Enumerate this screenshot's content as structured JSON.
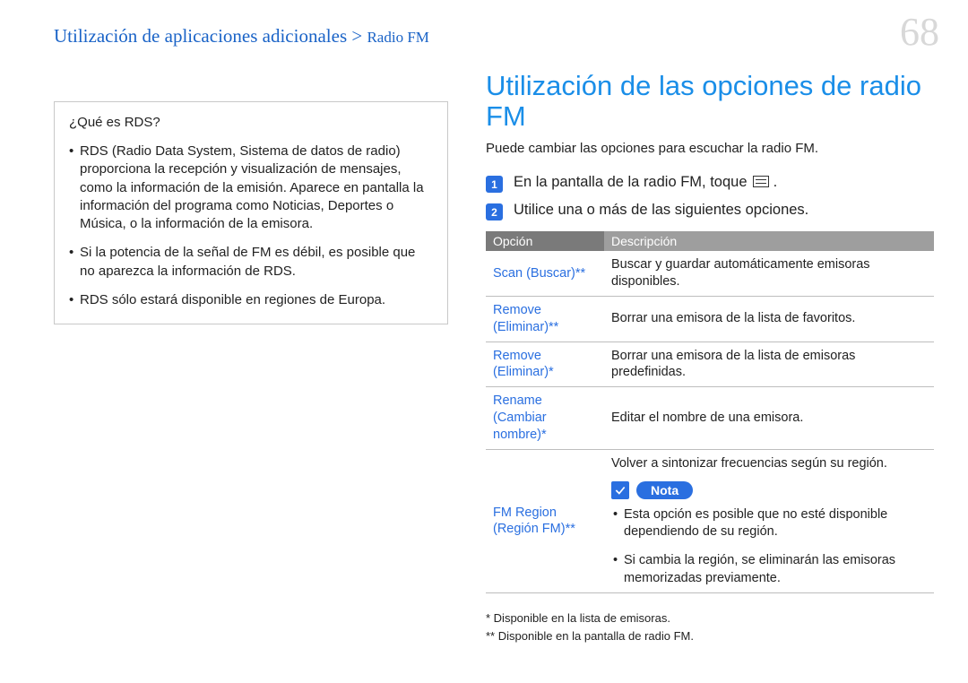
{
  "breadcrumb": {
    "main": "Utilización de aplicaciones adicionales",
    "separator": " > ",
    "sub": "Radio FM"
  },
  "page_number": "68",
  "box": {
    "title": "¿Qué es RDS?",
    "items": [
      "RDS (Radio Data System, Sistema de datos de radio) proporciona la recepción y visualización de mensajes, como la información de la emisión. Aparece en pantalla la información del programa como Noticias, Deportes o Música, o la información de la emisora.",
      "Si la potencia de la señal de FM es débil, es posible que no aparezca la información de RDS.",
      "RDS sólo estará disponible en regiones de Europa."
    ]
  },
  "section": {
    "title": "Utilización de las opciones de radio FM",
    "sub": "Puede cambiar las opciones para escuchar la radio FM."
  },
  "steps": {
    "s1": "En la pantalla de la radio FM, toque",
    "s2": "Utilice una o más de las siguientes opciones."
  },
  "table": {
    "head_option": "Opción",
    "head_desc": "Descripción",
    "rows": [
      {
        "option": "Scan (Buscar)**",
        "desc": "Buscar y guardar automáticamente emisoras disponibles."
      },
      {
        "option": "Remove (Eliminar)**",
        "desc": "Borrar una emisora de la lista de favoritos."
      },
      {
        "option": "Remove (Eliminar)*",
        "desc": "Borrar una emisora de la lista de emisoras predefinidas."
      },
      {
        "option": "Rename (Cambiar nombre)*",
        "desc": "Editar el nombre de una emisora."
      }
    ],
    "fm_region_option": "FM Region (Región FM)**",
    "fm_region_desc": "Volver a sintonizar frecuencias según su región.",
    "note_label": "Nota",
    "note_items": [
      "Esta opción es posible que no esté disponible dependiendo de su región.",
      "Si cambia la región, se eliminarán las emisoras memorizadas previamente."
    ]
  },
  "footnotes": {
    "f1": "* Disponible en la lista de emisoras.",
    "f2": "** Disponible en la pantalla de radio FM."
  }
}
